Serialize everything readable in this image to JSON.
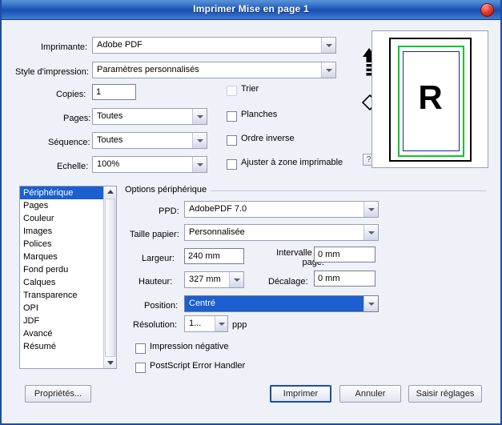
{
  "window": {
    "title": "Imprimer Mise en page 1",
    "close_icon": "close-icon"
  },
  "top_form": {
    "printer": {
      "label": "Imprimante:",
      "value": "Adobe PDF"
    },
    "style": {
      "label": "Style d'impression:",
      "value": "Paramètres personnalisés"
    },
    "copies": {
      "label": "Copies:",
      "value": "1"
    },
    "collate": {
      "label": "Trier",
      "checked": false,
      "disabled": true
    },
    "pages": {
      "label": "Pages:",
      "value": "Toutes"
    },
    "spreads": {
      "label": "Planches",
      "checked": false
    },
    "sequence": {
      "label": "Séquence:",
      "value": "Toutes"
    },
    "reverse": {
      "label": "Ordre inverse",
      "checked": false
    },
    "scale": {
      "label": "Echelle:",
      "value": "100%"
    },
    "fit": {
      "label": "Ajuster à zone imprimable",
      "checked": false
    }
  },
  "preview": {
    "page_letter": "R",
    "orientation_icon": "up-arrow-icon",
    "rotate_icon": "rotate-diamond-icon",
    "help_label": "?",
    "bleed_color": "#12c42a",
    "type_color": "#1a2a8c"
  },
  "category_list": {
    "items": [
      "Périphérique",
      "Pages",
      "Couleur",
      "Images",
      "Polices",
      "Marques",
      "Fond perdu",
      "Calques",
      "Transparence",
      "OPI",
      "JDF",
      "Avancé",
      "Résumé"
    ],
    "selected_index": 0
  },
  "device_options": {
    "group_title": "Options périphérique",
    "ppd": {
      "label": "PPD:",
      "value": "AdobePDF 7.0"
    },
    "paper_size": {
      "label": "Taille papier:",
      "value": "Personnalisée"
    },
    "width": {
      "label": "Largeur:",
      "value": "240 mm"
    },
    "height": {
      "label": "Hauteur:",
      "value": "327 mm"
    },
    "page_gap": {
      "label": "Intervalle de page:",
      "value": "0 mm"
    },
    "offset": {
      "label": "Décalage:",
      "value": "0 mm"
    },
    "position": {
      "label": "Position:",
      "value": "Centré",
      "selected": true
    },
    "resolution": {
      "label": "Résolution:",
      "value": "1...",
      "unit": "ppp"
    },
    "negative": {
      "label": "Impression négative",
      "checked": false
    },
    "ps_error": {
      "label": "PostScript Error Handler",
      "checked": false
    }
  },
  "footer": {
    "properties": "Propriétés...",
    "print": "Imprimer",
    "cancel": "Annuler",
    "save_preset": "Saisir réglages"
  },
  "colors": {
    "titlebar": "#1d57b8",
    "selection": "#1b5fd0",
    "window_border": "#1c4ea3",
    "background": "#eef1f8"
  }
}
